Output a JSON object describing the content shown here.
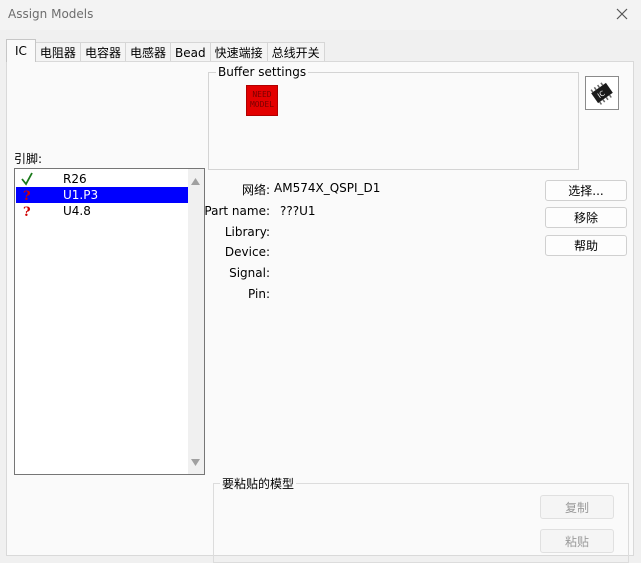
{
  "window": {
    "title": "Assign Models"
  },
  "tabs": [
    {
      "label": "IC",
      "active": true
    },
    {
      "label": "电阻器"
    },
    {
      "label": "电容器"
    },
    {
      "label": "电感器"
    },
    {
      "label": "Bead"
    },
    {
      "label": "快速端接"
    },
    {
      "label": "总线开关"
    }
  ],
  "buffer": {
    "legend": "Buffer settings",
    "image_text_1": "NEED",
    "image_text_2": "MODEL"
  },
  "pins": {
    "label": "引脚:",
    "items": [
      {
        "name": "R26",
        "status": "check",
        "selected": false
      },
      {
        "name": "U1.P3",
        "status": "question",
        "selected": true
      },
      {
        "name": "U4.8",
        "status": "question",
        "selected": false
      }
    ]
  },
  "info": {
    "net_label": "网络:",
    "net_value": "AM574X_QSPI_D1",
    "partname_label": "Part name:",
    "partname_value": "???U1",
    "library_label": "Library:",
    "device_label": "Device:",
    "signal_label": "Signal:",
    "pin_label": "Pin:"
  },
  "buttons": {
    "select": "选择...",
    "remove": "移除",
    "help": "帮助",
    "copy": "复制",
    "paste": "粘贴"
  },
  "paste_group": {
    "legend": "要粘贴的模型"
  },
  "colors": {
    "selection": "#0000ff",
    "check": "#1a7a1a",
    "question": "#d00000",
    "need_model": "#e30000"
  }
}
